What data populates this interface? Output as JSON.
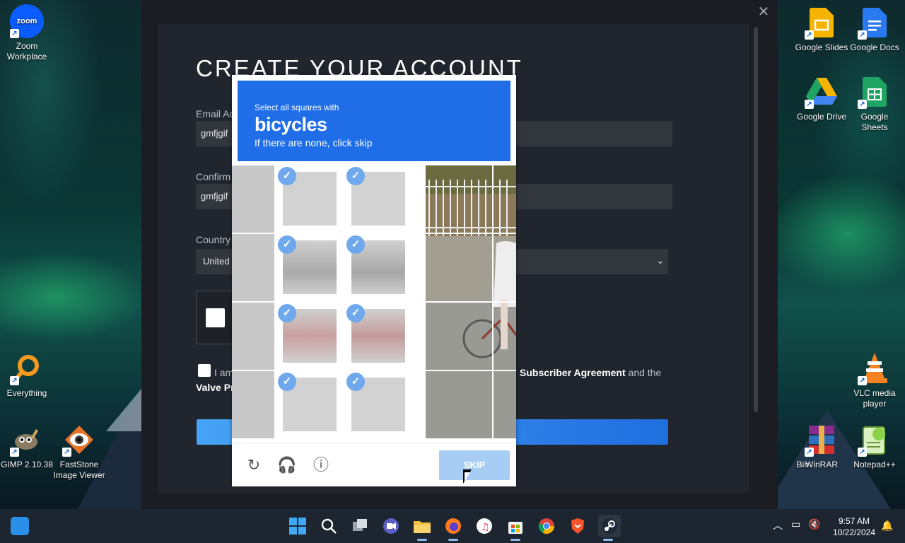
{
  "steam": {
    "title": "CREATE YOUR ACCOUNT",
    "email_label": "Email Ac",
    "email_value": "gmfjgif",
    "confirm_label": "Confirm",
    "confirm_value": "gmfjgif",
    "country_label": "Country",
    "country_value": "United",
    "agree_text_start": "I am",
    "agree_text_end_bold": "Subscriber Agreement",
    "agree_text_end": " and the",
    "privacy_text": "Valve Pr",
    "close_glyph": "✕",
    "chevron_glyph": "⌄"
  },
  "hcaptcha": {
    "prompt": "Select all squares with",
    "target": "bicycles",
    "hint": "If there are none, click skip",
    "skip_label": "SKIP",
    "check_glyph": "✓",
    "refresh_glyph": "↻",
    "audio_glyph": "🎧",
    "info_glyph": "ⓘ"
  },
  "desktop": {
    "icons": [
      {
        "label": "Zoom Workplace",
        "icon": "zoom-icon"
      },
      {
        "label": "Everything",
        "icon": "everything-icon"
      },
      {
        "label": "GIMP 2.10.38",
        "icon": "gimp-icon"
      },
      {
        "label": "FastStone Image Viewer",
        "icon": "faststone-icon"
      },
      {
        "label": "Google Slides",
        "icon": "google-slides-icon"
      },
      {
        "label": "Google Docs",
        "icon": "google-docs-icon"
      },
      {
        "label": "Google Drive",
        "icon": "google-drive-icon"
      },
      {
        "label": "Google Sheets",
        "icon": "google-sheets-icon"
      },
      {
        "label": "VLC media player",
        "icon": "vlc-icon"
      },
      {
        "label": "Bin",
        "icon": "recycle-bin-icon"
      },
      {
        "label": "WinRAR",
        "icon": "winrar-icon"
      },
      {
        "label": "Notepad++",
        "icon": "notepad-plus-plus-icon"
      }
    ],
    "zoom_text": "zoom"
  },
  "taskbar": {
    "time": "9:57 AM",
    "date": "10/22/2024"
  }
}
